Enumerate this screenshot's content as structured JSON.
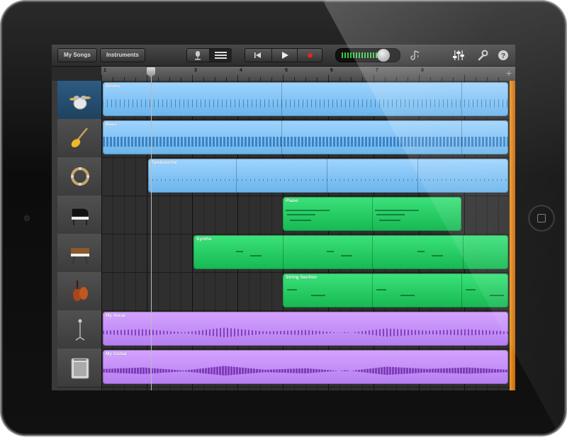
{
  "toolbar": {
    "my_songs_label": "My Songs",
    "instruments_label": "Instruments",
    "icons": {
      "microphone": "microphone-icon",
      "track_list": "track-list-icon",
      "rewind": "rewind-icon",
      "play": "play-icon",
      "record": "record-icon",
      "metronome": "metronome-icon",
      "mixer": "mixer-sliders-icon",
      "settings": "wrench-icon",
      "help": "help-icon"
    },
    "record_color": "#e0242a",
    "meter_color": "#37e04a"
  },
  "ruler": {
    "bars": [
      "1",
      "2",
      "3",
      "4",
      "5",
      "6",
      "7",
      "8"
    ],
    "add_label": "+"
  },
  "tracks": [
    {
      "instrument": "drum-kit-icon",
      "region_color": "#8ac8f8",
      "regions": [
        {
          "label": "Drums"
        }
      ]
    },
    {
      "instrument": "bass-guitar-icon",
      "region_color": "#8ac8f8",
      "regions": [
        {
          "label": "Bass"
        }
      ]
    },
    {
      "instrument": "tambourine-icon",
      "region_color": "#8ac8f8",
      "regions": [
        {
          "label": "Tambourine"
        }
      ]
    },
    {
      "instrument": "grand-piano-icon",
      "region_color": "#26cf66",
      "regions": [
        {
          "label": "Piano"
        }
      ]
    },
    {
      "instrument": "synthesizer-icon",
      "region_color": "#26cf66",
      "regions": [
        {
          "label": "Synths"
        }
      ]
    },
    {
      "instrument": "violin-icon",
      "region_color": "#26cf66",
      "regions": [
        {
          "label": "String Section"
        }
      ]
    },
    {
      "instrument": "microphone-stand-icon",
      "region_color": "#c592f8",
      "regions": [
        {
          "label": "My Vocal"
        }
      ]
    },
    {
      "instrument": "guitar-amp-icon",
      "region_color": "#c592f8",
      "regions": [
        {
          "label": "My Guitar"
        }
      ]
    }
  ]
}
